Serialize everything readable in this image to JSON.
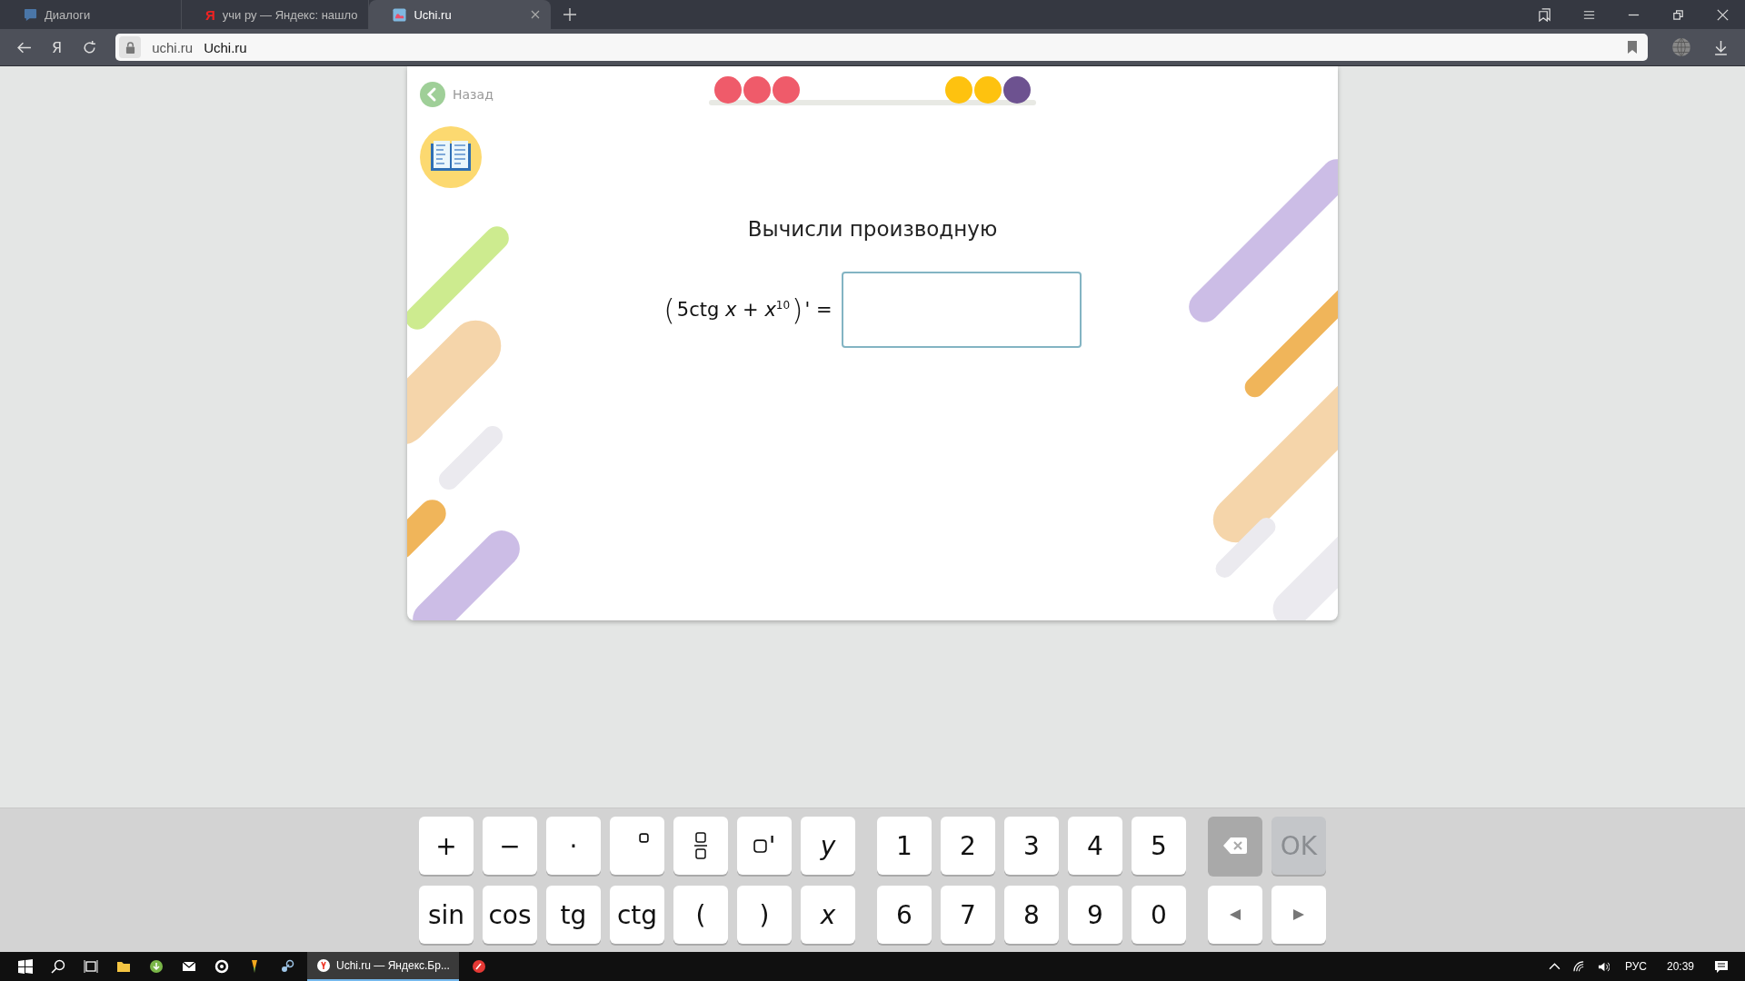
{
  "browser": {
    "tabs": [
      {
        "title": "Диалоги",
        "selected": false,
        "kind": "chat"
      },
      {
        "title": "учи ру — Яндекс: нашло",
        "selected": false,
        "kind": "letter",
        "favicon_text": "Я"
      },
      {
        "title": "Uchi.ru",
        "selected": true,
        "kind": "picture"
      }
    ],
    "logo_text": "Я",
    "address": {
      "domain": "uchi.ru",
      "title": "Uchi.ru"
    }
  },
  "page": {
    "back": "Назад",
    "progress": {
      "dots_start": [
        {
          "color": "#ef5b6a"
        },
        {
          "color": "#ef5b6a"
        },
        {
          "color": "#ef5b6a"
        }
      ],
      "dots_end": [
        {
          "color": "#fec20f"
        },
        {
          "color": "#fec20f"
        },
        {
          "color": "#6d5290"
        }
      ]
    },
    "title": "Вычисли производную",
    "formula": {
      "open": "(",
      "body": "5ctg *x* + *x*$^{10}$",
      "close": ")",
      "tail": "' ="
    }
  },
  "keyboard": {
    "groups": [
      {
        "keys": [
          {
            "kind": "text",
            "label": "+"
          },
          {
            "kind": "text",
            "label": "−"
          },
          {
            "kind": "text",
            "label": "·"
          },
          {
            "kind": "degree"
          },
          {
            "kind": "fraction"
          },
          {
            "kind": "prime",
            "label": "'"
          },
          {
            "kind": "italic",
            "label": "y"
          },
          {
            "kind": "text",
            "label": "sin"
          },
          {
            "kind": "text",
            "label": "cos"
          },
          {
            "kind": "text",
            "label": "tg"
          },
          {
            "kind": "text",
            "label": "ctg"
          },
          {
            "kind": "text",
            "label": "("
          },
          {
            "kind": "text",
            "label": ")"
          },
          {
            "kind": "italic",
            "label": "x"
          }
        ]
      },
      {
        "keys": [
          {
            "kind": "text",
            "label": "1"
          },
          {
            "kind": "text",
            "label": "2"
          },
          {
            "kind": "text",
            "label": "3"
          },
          {
            "kind": "text",
            "label": "4"
          },
          {
            "kind": "text",
            "label": "5"
          },
          {
            "kind": "text",
            "label": "6"
          },
          {
            "kind": "text",
            "label": "7"
          },
          {
            "kind": "text",
            "label": "8"
          },
          {
            "kind": "text",
            "label": "9"
          },
          {
            "kind": "text",
            "label": "0"
          }
        ]
      },
      {
        "keys": [
          {
            "kind": "backspace",
            "disabled": true
          },
          {
            "kind": "text",
            "label": "OK",
            "disabled": true
          },
          {
            "kind": "left"
          },
          {
            "kind": "right"
          }
        ]
      }
    ]
  },
  "taskbar": {
    "active_app": "Uchi.ru — Яндекс.Бр...",
    "language": "РУС",
    "time": "20:39"
  }
}
